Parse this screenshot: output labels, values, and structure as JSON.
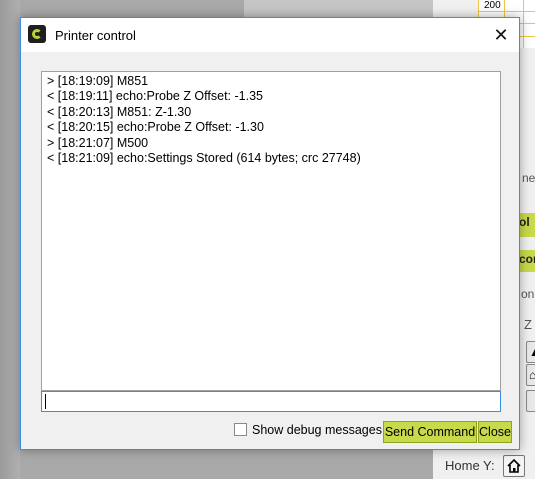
{
  "window": {
    "title": "Printer control",
    "close_glyph": "✕"
  },
  "log": {
    "lines": [
      "> [18:19:09] M851",
      "< [18:19:11] echo:Probe Z Offset: -1.35",
      "< [18:20:13] M851: Z-1.30",
      "< [18:20:15] echo:Probe Z Offset: -1.30",
      "> [18:21:07] M500",
      "< [18:21:09] echo:Settings Stored (614 bytes; crc 27748)"
    ]
  },
  "command_input": {
    "value": "",
    "placeholder": ""
  },
  "footer": {
    "debug_label": "Show debug messages",
    "debug_checked": false,
    "send_label": "Send Command",
    "close_label": "Close"
  },
  "background": {
    "grid_value": "200",
    "fragments": [
      "ne",
      "ol",
      "cor",
      "on",
      "Z"
    ],
    "home_y_label": "Home Y:"
  },
  "colors": {
    "accent_green": "#c8d94a",
    "focus_blue": "#3a8ee6"
  },
  "icons": [
    "app-logo-icon",
    "close-icon",
    "home-icon",
    "arrow-up-icon"
  ]
}
